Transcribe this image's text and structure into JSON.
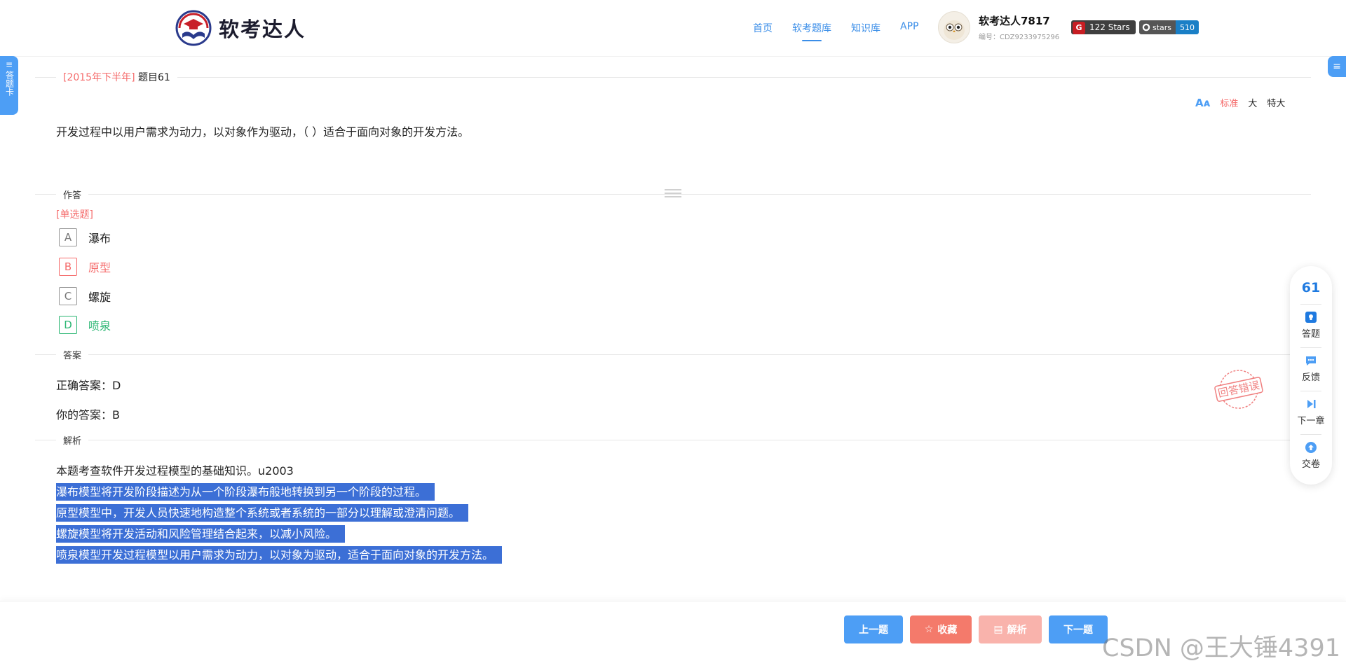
{
  "brand": {
    "name": "软考达人"
  },
  "nav": [
    {
      "label": "首页"
    },
    {
      "label": "软考题库",
      "active": true
    },
    {
      "label": "知识库"
    },
    {
      "label": "APP"
    }
  ],
  "user": {
    "name": "软考达人7817",
    "id": "编号：CDZ9233975296"
  },
  "badges": {
    "gitee_label": "122 Stars",
    "github_left": "stars",
    "github_right": "510"
  },
  "side": {
    "answer_card": "答题卡"
  },
  "question": {
    "source": "[2015年下半年]",
    "number": "题目61",
    "text": "开发过程中以用户需求为动力，以对象作为驱动，（ ）适合于面向对象的开发方法。",
    "type": "[单选题]",
    "options": [
      {
        "letter": "A",
        "text": "瀑布",
        "state": "normal"
      },
      {
        "letter": "B",
        "text": "原型",
        "state": "wrong"
      },
      {
        "letter": "C",
        "text": "螺旋",
        "state": "normal"
      },
      {
        "letter": "D",
        "text": "喷泉",
        "state": "correct"
      }
    ]
  },
  "font_size": {
    "standard": "标准",
    "large": "大",
    "xlarge": "特大"
  },
  "sections": {
    "answer_area": "作答",
    "answer": "答案",
    "analysis": "解析"
  },
  "answer": {
    "correct": "正确答案：D",
    "yours": "你的答案：B",
    "stamp": "回答错误"
  },
  "analysis": {
    "lines": [
      "本题考查软件开发过程模型的基础知识。u2003",
      "瀑布模型将开发阶段描述为从一个阶段瀑布般地转换到另一个阶段的过程。",
      "原型模型中，开发人员快速地构造整个系统或者系统的一部分以理解或澄清问题。",
      "螺旋模型将开发活动和风险管理结合起来，以减小风险。",
      "喷泉模型开发过程模型以用户需求为动力，以对象为驱动，适合于面向对象的开发方法。"
    ]
  },
  "float_bar": {
    "current": "61",
    "items": [
      {
        "label": "答题",
        "icon": "answer-icon"
      },
      {
        "label": "反馈",
        "icon": "feedback-icon"
      },
      {
        "label": "下一章",
        "icon": "next-chapter-icon"
      },
      {
        "label": "交卷",
        "icon": "submit-icon"
      }
    ]
  },
  "bottom_buttons": {
    "prev": "上一题",
    "favorite": "收藏",
    "analysis": "解析",
    "next": "下一题"
  },
  "watermark": "CSDN @王大锤4391",
  "colors": {
    "primary": "#4d9ef5",
    "wrong": "#f56c6c",
    "correct": "#2bb673",
    "highlight": "#3c6fd6"
  }
}
